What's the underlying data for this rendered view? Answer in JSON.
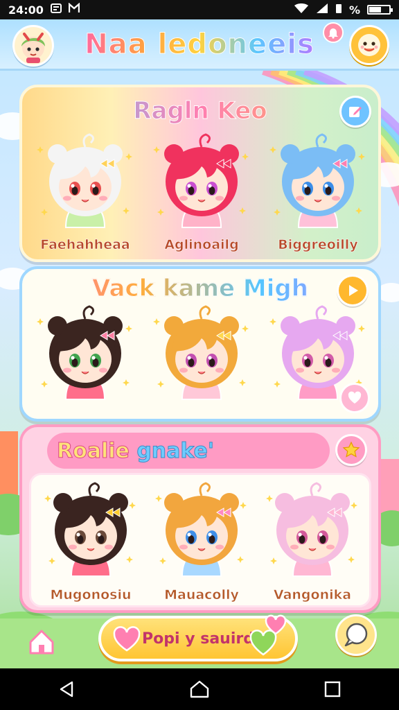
{
  "status_bar": {
    "time": "24:00",
    "left_icons": [
      "notification-icon",
      "gallery-icon"
    ],
    "battery_text": "%",
    "battery_level": 0.6
  },
  "header": {
    "title": "Naa ledoneeis",
    "avatar_icon": "avatar-icon",
    "notification_icon": "bell-icon",
    "chat_icon": "chat-face-icon"
  },
  "panels": [
    {
      "title": "Ragln Keo",
      "corner_icon": "edit-icon",
      "characters": [
        {
          "name": "Faehahheaa",
          "hair": "#f4f4f4",
          "eyes": "#e84f4f",
          "outfit": "#c9f0a8",
          "accessory": "#ffd25a"
        },
        {
          "name": "Aglinoailg",
          "hair": "#f0325e",
          "eyes": "#c94fd0",
          "outfit": "#ffb2c8",
          "accessory": "#f0325e"
        },
        {
          "name": "Biggreoilly",
          "hair": "#7bbdf5",
          "eyes": "#3a8de8",
          "outfit": "#ffc1d9",
          "accessory": "#ff7fb1"
        }
      ]
    },
    {
      "title": "Vack kame Migh",
      "corner_icon": "play-icon",
      "heart_icon": "heart-icon",
      "characters": [
        {
          "hair": "#3b2520",
          "eyes": "#3fa34d",
          "outfit": "#ff6d8a",
          "accessory": "#ff7fa3"
        },
        {
          "hair": "#f2a93b",
          "eyes": "#c24fb0",
          "outfit": "#ffc8d8",
          "accessory": "#ffd84d"
        },
        {
          "hair": "#e6a8f0",
          "eyes": "#d25aa8",
          "outfit": "#ff9cc6",
          "accessory": "#e6a8f0"
        }
      ]
    },
    {
      "title_part1": "Roalie",
      "title_part2": "gnake'",
      "corner_icon": "star-icon",
      "characters": [
        {
          "name": "Mugonosiu",
          "hair": "#3a2420",
          "eyes": "#6b4a3a",
          "outfit": "#ff6d8a",
          "accessory": "#ffcc2e"
        },
        {
          "name": "Mauacolly",
          "hair": "#f2a63e",
          "eyes": "#3f8ee8",
          "outfit": "#a8d8ff",
          "accessory": "#ff8ac0"
        },
        {
          "name": "Vangonika",
          "hair": "#f6bde0",
          "eyes": "#d35a9a",
          "outfit": "#ffb7d3",
          "accessory": "#ffb7d3"
        }
      ]
    }
  ],
  "bottom_bar": {
    "home_icon": "home-icon",
    "play_label": "Popi y sauird",
    "bubble_icon": "speech-bubble-icon"
  },
  "nav_bar": {
    "icons": [
      "back-icon",
      "home-nav-icon",
      "recents-icon"
    ]
  },
  "colors": {
    "rainbow": [
      "#ff8fb8",
      "#ffc36b",
      "#fff07a",
      "#9ee58a",
      "#7fd0ff",
      "#c39bff"
    ]
  }
}
